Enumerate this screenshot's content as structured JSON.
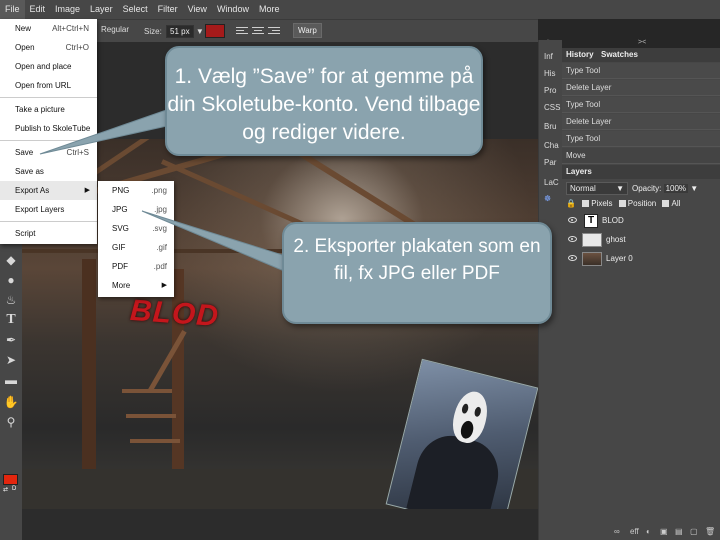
{
  "menubar": [
    "File",
    "Edit",
    "Image",
    "Layer",
    "Select",
    "Filter",
    "View",
    "Window",
    "More"
  ],
  "options": {
    "font_style": "Regular",
    "size_label": "Size:",
    "size_value": "51 px",
    "warp": "Warp"
  },
  "file_menu": {
    "items": [
      {
        "label": "New",
        "shortcut": "Alt+Ctrl+N"
      },
      {
        "label": "Open",
        "shortcut": "Ctrl+O"
      },
      {
        "label": "Open and place",
        "shortcut": ""
      },
      {
        "label": "Open from URL",
        "shortcut": ""
      },
      {
        "label": "Take a picture",
        "shortcut": ""
      },
      {
        "label": "Publish to SkoleTube",
        "shortcut": ""
      },
      {
        "label": "Save",
        "shortcut": "Ctrl+S"
      },
      {
        "label": "Save as",
        "shortcut": ""
      },
      {
        "label": "Export As",
        "shortcut": ""
      },
      {
        "label": "Export Layers",
        "shortcut": ""
      },
      {
        "label": "Script",
        "shortcut": ""
      }
    ]
  },
  "export_submenu": [
    {
      "label": "PNG",
      "ext": ".png"
    },
    {
      "label": "JPG",
      "ext": ".jpg"
    },
    {
      "label": "SVG",
      "ext": ".svg"
    },
    {
      "label": "GIF",
      "ext": ".gif"
    },
    {
      "label": "PDF",
      "ext": ".pdf"
    },
    {
      "label": "More",
      "ext": ""
    }
  ],
  "canvas": {
    "text_layer": "BLOD"
  },
  "mini_tabs": [
    "Inf",
    "His",
    "Pro",
    "CSS",
    "Bru",
    "Cha",
    "Par",
    "LaC"
  ],
  "history": {
    "tabs": [
      "History",
      "Swatches"
    ],
    "items": [
      "Type Tool",
      "Delete Layer",
      "Type Tool",
      "Delete Layer",
      "Type Tool",
      "Move"
    ]
  },
  "layers": {
    "tab": "Layers",
    "blend_mode": "Normal",
    "opacity_label": "Opacity:",
    "opacity_value": "100%",
    "lock_label": "",
    "lock_options": [
      "Pixels",
      "Position",
      "All"
    ],
    "items": [
      "BLOD",
      "ghost",
      "Layer 0"
    ]
  },
  "bottom": {
    "eff": "eff"
  },
  "callouts": {
    "one": "1. Vælg ”Save” for at gemme på din Skoletube-konto. Vend tilbage og rediger videre.",
    "two": "2. Eksporter plakaten som en fil, fx JPG eller PDF"
  },
  "colors": {
    "foreground": "#e3260e",
    "text_color": "#a51a1a",
    "callout": "#8aa3ae"
  }
}
